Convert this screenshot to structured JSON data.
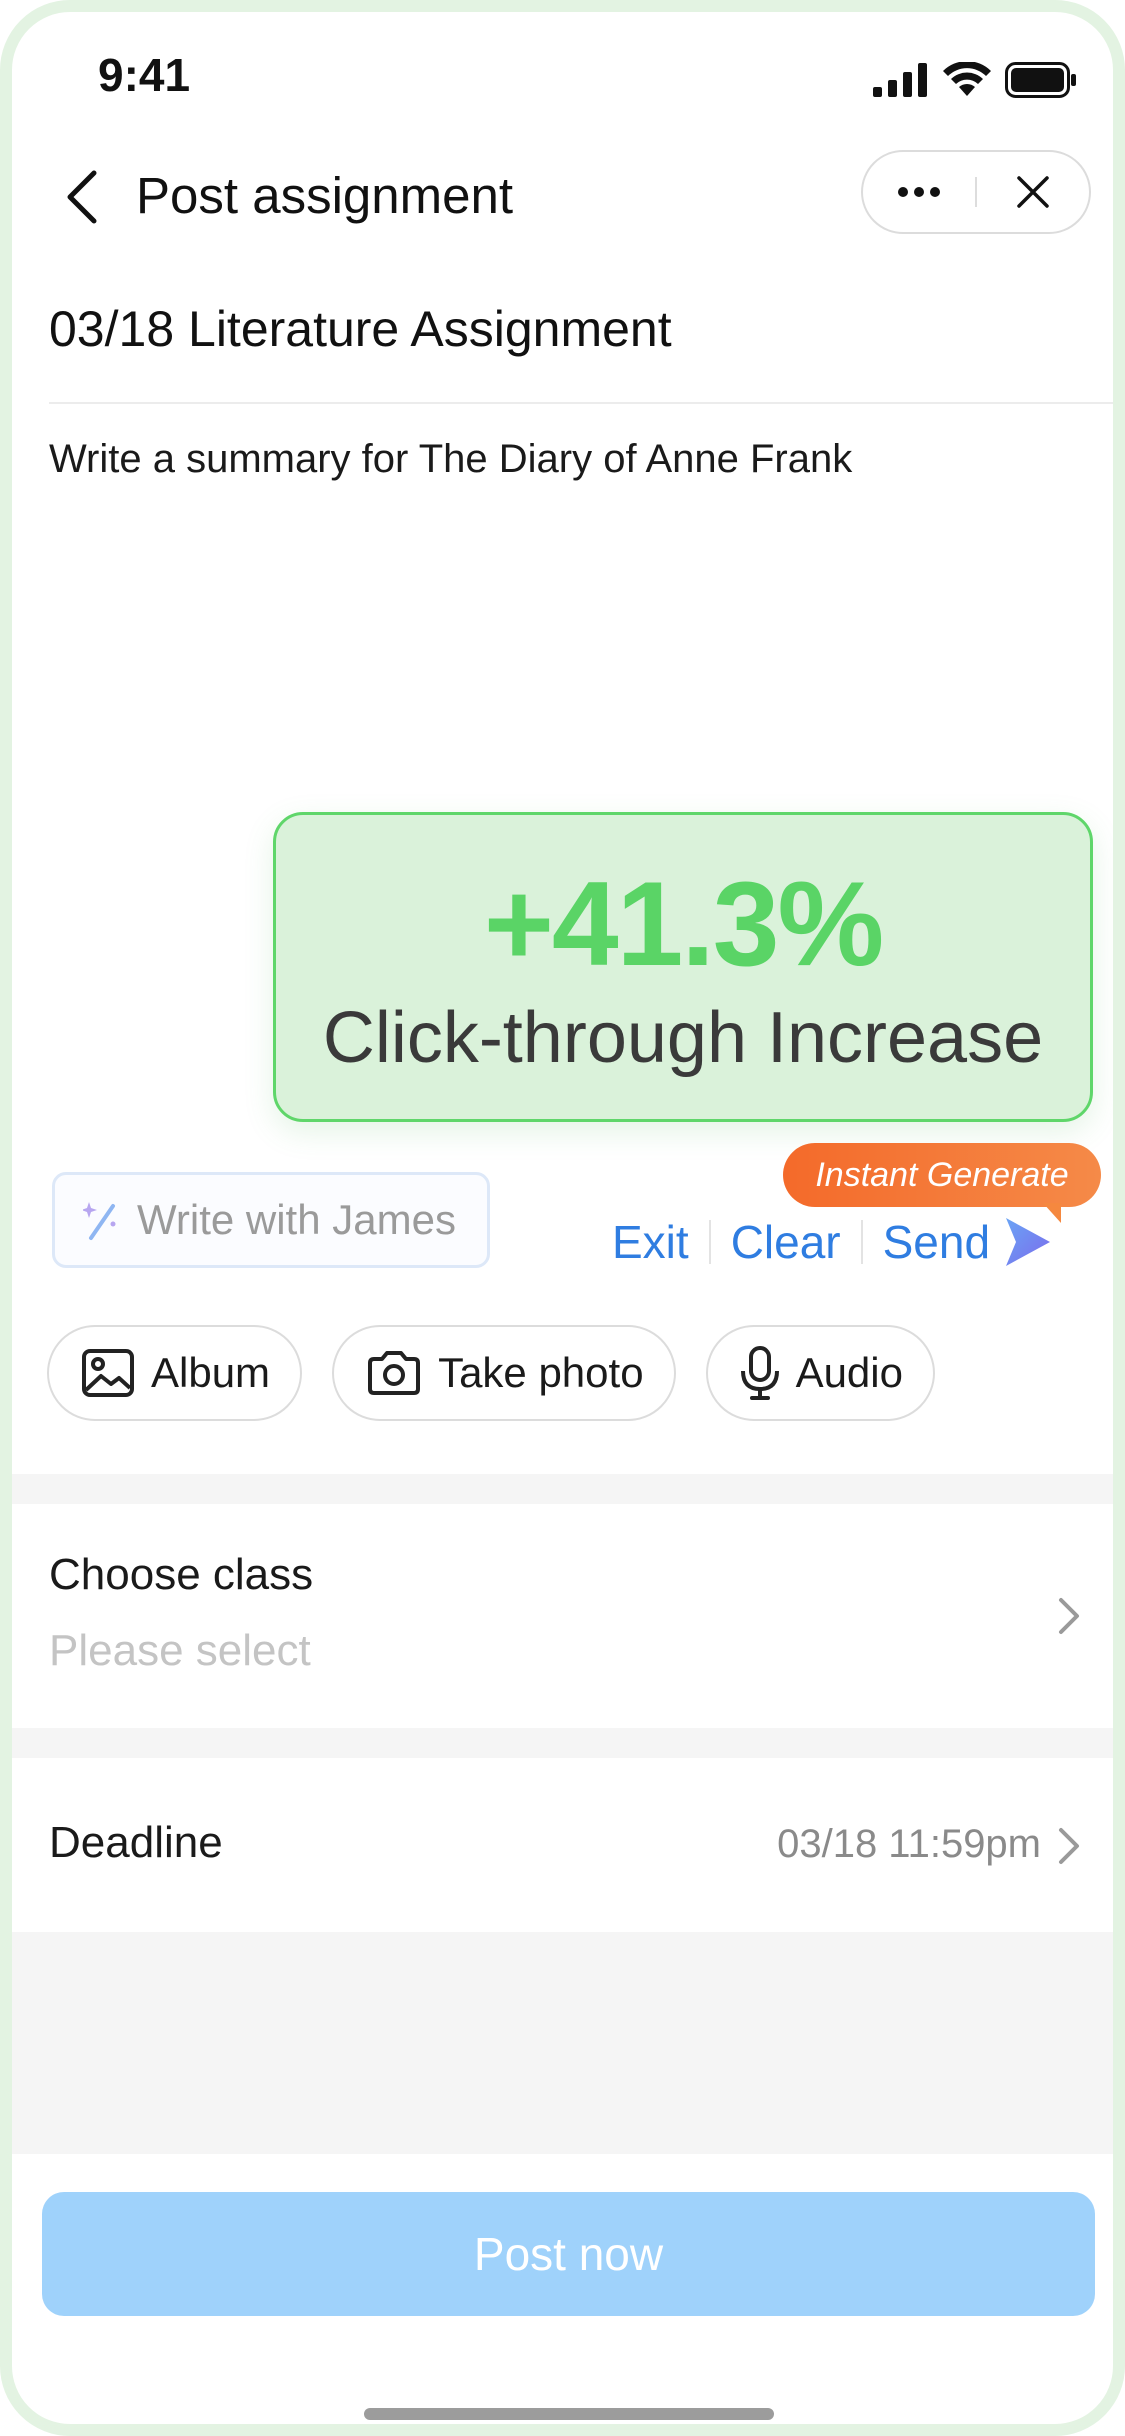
{
  "status_bar": {
    "time": "9:41"
  },
  "nav": {
    "title": "Post assignment"
  },
  "assignment": {
    "title": "03/18 Literature Assignment",
    "body": "Write a summary for The Diary of Anne Frank"
  },
  "callout": {
    "value": "+41.3%",
    "label": "Click-through Increase"
  },
  "ai_bar": {
    "write_label": "Write with James",
    "badge": "Instant Generate",
    "exit_label": "Exit",
    "clear_label": "Clear",
    "send_label": "Send"
  },
  "attachments": [
    {
      "label": "Album",
      "icon": "image-icon"
    },
    {
      "label": "Take photo",
      "icon": "camera-icon"
    },
    {
      "label": "Audio",
      "icon": "microphone-icon"
    }
  ],
  "choose_class": {
    "label": "Choose class",
    "placeholder": "Please select"
  },
  "deadline": {
    "label": "Deadline",
    "value": "03/18 11:59pm"
  },
  "post_button": "Post now",
  "colors": {
    "accent_blue": "#2f7de1",
    "callout_green": "#5ad466",
    "badge_orange": "#f46a2a",
    "post_button": "#9fd2fb"
  }
}
